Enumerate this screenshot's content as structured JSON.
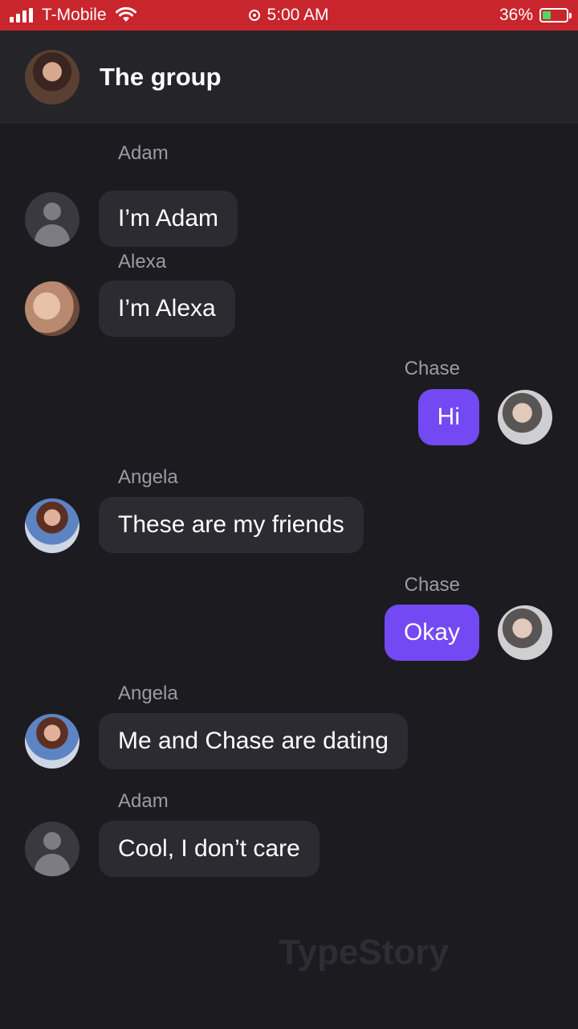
{
  "status_bar": {
    "carrier": "T-Mobile",
    "time": "5:00 AM",
    "battery": "36%",
    "battery_level": 0.36
  },
  "header": {
    "title": "The group"
  },
  "messages": [
    {
      "sender": "Adam",
      "text": "I’m Adam",
      "direction": "incoming",
      "avatar": "default-avatar"
    },
    {
      "sender": "Alexa",
      "text": "I’m Alexa",
      "direction": "incoming",
      "avatar": "alexa-avatar"
    },
    {
      "sender": "Chase",
      "text": "Hi",
      "direction": "outgoing",
      "avatar": "chase-avatar"
    },
    {
      "sender": "Angela",
      "text": "These are my friends",
      "direction": "incoming",
      "avatar": "angela-avatar"
    },
    {
      "sender": "Chase",
      "text": "Okay",
      "direction": "outgoing",
      "avatar": "chase-avatar"
    },
    {
      "sender": "Angela",
      "text": "Me and Chase are dating",
      "direction": "incoming",
      "avatar": "angela-avatar"
    },
    {
      "sender": "Adam",
      "text": "Cool, I don’t care",
      "direction": "incoming",
      "avatar": "default-avatar"
    }
  ],
  "watermark": "TypeStory",
  "colors": {
    "status_bar": "#c9252c",
    "background": "#1c1b20",
    "header": "#252429",
    "incoming_bubble": "#2c2b31",
    "outgoing_bubble": "#7349f3",
    "sender_name": "#9c9aa3"
  }
}
